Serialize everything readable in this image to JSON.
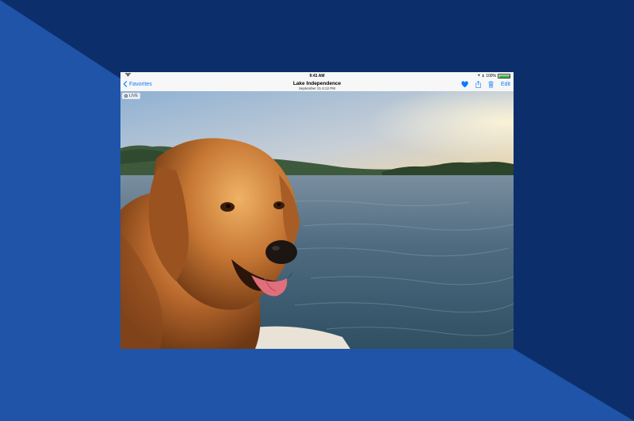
{
  "status_bar": {
    "time": "9:41 AM",
    "battery": "100%",
    "battery_level": 1.0
  },
  "nav": {
    "back_label": "Favorites",
    "title": "Lake Independence",
    "subtitle": "September 21  6:12 PM",
    "edit_label": "Edit"
  },
  "photo": {
    "live_label": "LIVE"
  },
  "colors": {
    "accent": "#0a7aff",
    "background_light": "#1f54a8",
    "background_dark": "#0c2f6b",
    "bar": "#f7f7f7"
  },
  "icons": {
    "back": "chevron-left-icon",
    "favorite": "heart-icon",
    "share": "share-icon",
    "delete": "trash-icon",
    "wifi": "wifi-icon",
    "live": "live-photo-icon"
  }
}
